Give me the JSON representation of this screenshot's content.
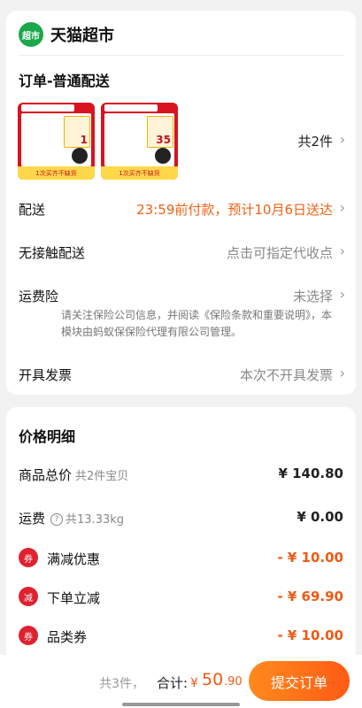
{
  "store": {
    "logo_text": "超市",
    "name": "天猫超市"
  },
  "order": {
    "section_title": "订单-普通配送",
    "products": [
      {
        "banner": "1次买齐不缺货",
        "badge_number": "1"
      },
      {
        "banner": "1次买齐不缺货",
        "badge_number": "35"
      }
    ],
    "count_text": "共2件",
    "rows": {
      "delivery": {
        "label": "配送",
        "value": "23:59前付款，预计10月6日送达"
      },
      "contactless": {
        "label": "无接触配送",
        "value": "点击可指定代收点"
      },
      "insurance": {
        "label": "运费险",
        "value": "未选择"
      },
      "invoice": {
        "label": "开具发票",
        "value": "本次不开具发票"
      }
    },
    "insurance_note": "请关注保险公司信息，并阅读《保险条款和重要说明》，本模块由蚂蚁保保险代理有限公司管理。"
  },
  "price": {
    "title": "价格明细",
    "goods_total": {
      "label": "商品总价",
      "sub": "共2件宝贝",
      "value": "¥ 140.80"
    },
    "shipping": {
      "label": "运费",
      "help": "?",
      "sub": "共13.33kg",
      "value": "¥ 0.00"
    },
    "discounts": [
      {
        "icon": "券",
        "label": "满减优惠",
        "value": "- ¥ 10.00"
      },
      {
        "icon": "减",
        "label": "下单立减",
        "value": "- ¥ 69.90"
      },
      {
        "icon": "券",
        "label": "品类券",
        "value": "- ¥ 10.00"
      }
    ]
  },
  "bottom": {
    "count": "共3件，",
    "total_label": "合计:",
    "currency": "¥",
    "amount_int": "50",
    "amount_dec": ".90",
    "submit_label": "提交订单"
  },
  "icons": {
    "chevron": "chevron-right-icon",
    "help": "question-circle-icon"
  },
  "colors": {
    "accent": "#ee6214",
    "brand_green": "#1aa84b",
    "discount_red": "#e0212f"
  }
}
